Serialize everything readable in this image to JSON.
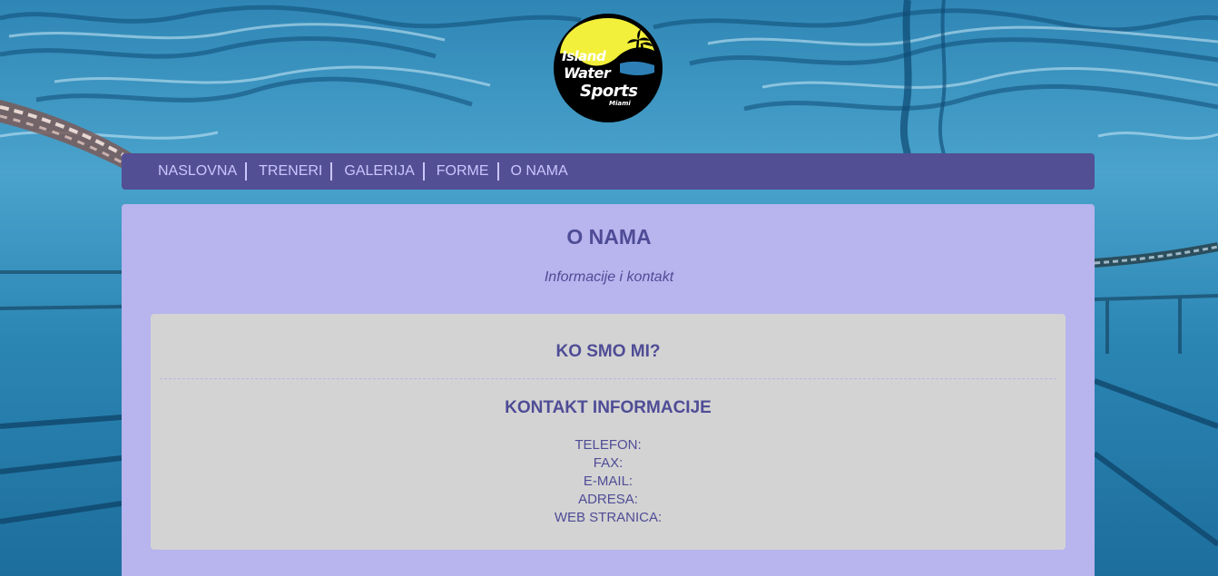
{
  "logo": {
    "line1": "Island",
    "line2": "Water",
    "line3": "Sports",
    "line4": "Miami"
  },
  "nav": {
    "items": [
      {
        "label": "NASLOVNA"
      },
      {
        "label": "TRENERI"
      },
      {
        "label": "GALERIJA"
      },
      {
        "label": "FORME"
      },
      {
        "label": "O NAMA"
      }
    ]
  },
  "main": {
    "title": "O NAMA",
    "subtitle": "Informacije i kontakt",
    "about_heading": "KO SMO MI?",
    "contact_heading": "KONTAKT INFORMACIJE",
    "contact_fields": [
      {
        "label": "TELEFON:"
      },
      {
        "label": "FAX:"
      },
      {
        "label": "E-MAIL:"
      },
      {
        "label": "ADRESA:"
      },
      {
        "label": "WEB STRANICA:"
      }
    ]
  },
  "colors": {
    "nav_background": "#524f94",
    "nav_text": "#c9c6ff",
    "content_background": "#b7b4ee",
    "card_background": "#d3d3d3",
    "heading_text": "#4f4c96",
    "logo_yellow": "#f2f03a",
    "pool_water": "#1b6c9a"
  }
}
